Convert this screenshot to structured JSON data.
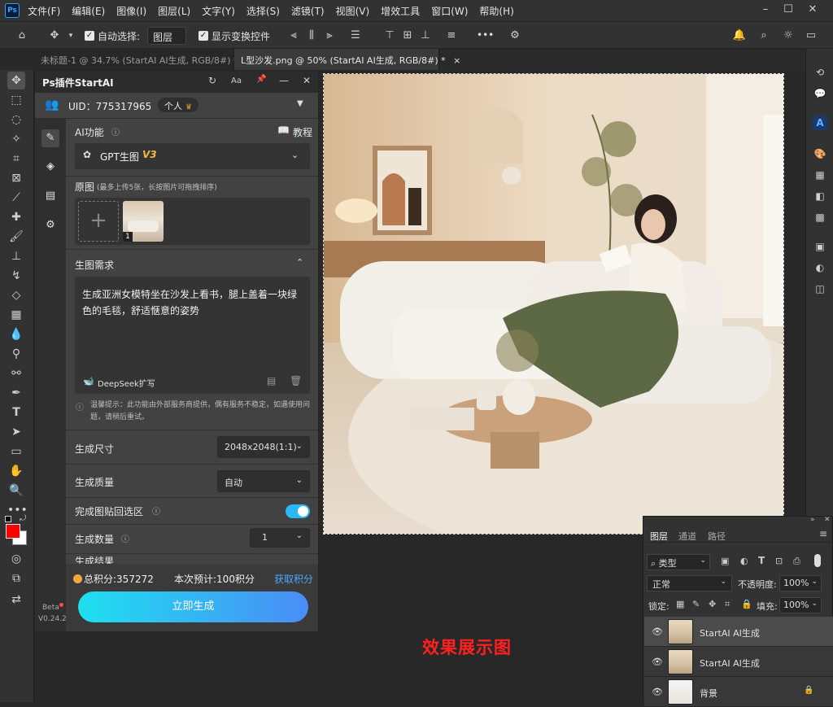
{
  "app": {
    "logo": "Ps",
    "menu": [
      "文件(F)",
      "编辑(E)",
      "图像(I)",
      "图层(L)",
      "文字(Y)",
      "选择(S)",
      "滤镜(T)",
      "视图(V)",
      "增效工具",
      "窗口(W)",
      "帮助(H)"
    ]
  },
  "options": {
    "auto_select_label": "自动选择:",
    "auto_select_value": "图层",
    "show_transform_label": "显示变换控件",
    "more": "•••"
  },
  "tabs": [
    {
      "label": "未标题-1 @ 34.7% (StartAI AI生成, RGB/8#) *",
      "close": "×"
    },
    {
      "label": "L型沙发.png @ 50% (StartAI AI生成, RGB/8#) *",
      "close": "×"
    }
  ],
  "plugin": {
    "title": "Ps插件StartAI",
    "head_icons": {
      "refresh": "↻",
      "font": "Aa",
      "pin": "📌",
      "minimize": "—",
      "close": "✕"
    },
    "uid_label": "UID：775317965",
    "account_type": "个人",
    "ai_function_label": "AI功能",
    "tutorial_label": "教程",
    "model_name": "GPT生图",
    "model_version": "V3",
    "original_label": "原图",
    "original_hint": "(最多上传5张，长按图片可拖拽排序)",
    "upload_plus": "+",
    "thumb_count": "1",
    "requirement_label": "生图需求",
    "prompt_text": "生成亚洲女模特坐在沙发上看书，腿上盖着一块绿色的毛毯，舒适惬意的姿势",
    "deepseek_label": "DeepSeek扩写",
    "notice_text": "温馨提示：此功能由外部服务商提供，偶有服务不稳定，如遇使用问题，请稍后重试。",
    "size_label": "生成尺寸",
    "size_value": "2048x2048(1:1)",
    "quality_label": "生成质量",
    "quality_value": "自动",
    "paste_back_label": "完成图贴回选区",
    "count_label": "生成数量",
    "count_value": "1",
    "cut_row_label": "生成结果",
    "points_label": "总积分:357272",
    "estimate_label": "本次预计:100积分",
    "get_points_label": "获取积分",
    "generate_label": "立即生成",
    "beta_label": "Beta",
    "version_label": "V0.24.2"
  },
  "caption": "效果展示图",
  "layers": {
    "tabs": [
      "图层",
      "通道",
      "路径"
    ],
    "kind_filter": "类型",
    "blend_mode": "正常",
    "opacity_label": "不透明度:",
    "opacity_value": "100%",
    "lock_label": "锁定:",
    "fill_label": "填充:",
    "fill_value": "100%",
    "items": [
      {
        "name": "StartAI AI生成",
        "selected": true
      },
      {
        "name": "StartAI AI生成",
        "selected": false
      },
      {
        "name": "背景",
        "selected": false
      }
    ]
  },
  "colors": {
    "accent_gradient_start": "#1ee0f0",
    "accent_gradient_end": "#4a8cf6",
    "toggle": "#2ab8f4",
    "caption": "#ff2020",
    "foreground": "#ff0000",
    "background": "#ffffff"
  }
}
